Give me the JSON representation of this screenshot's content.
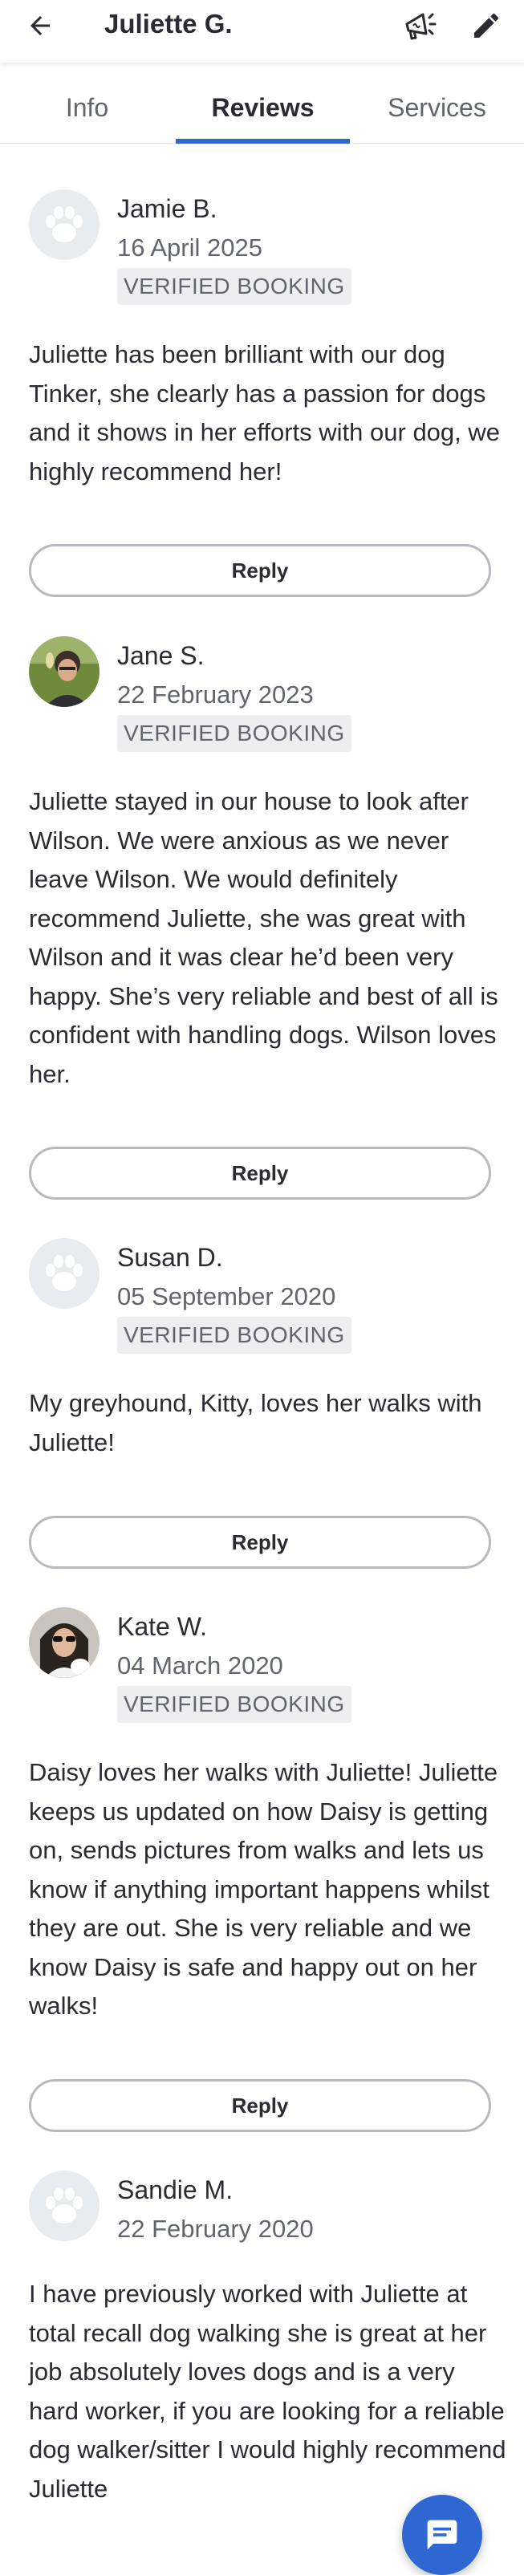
{
  "header": {
    "title": "Juliette G.",
    "back_icon": "arrow-left-icon",
    "promote_icon": "megaphone-icon",
    "edit_icon": "pencil-icon"
  },
  "tabs": [
    {
      "label": "Info",
      "active": false
    },
    {
      "label": "Reviews",
      "active": true
    },
    {
      "label": "Services",
      "active": false
    }
  ],
  "colors": {
    "accent": "#2e67d1",
    "text": "#2b2b33",
    "muted": "#62646e",
    "badge_bg": "#eeeef1"
  },
  "reviews": [
    {
      "name": "Jamie B.",
      "date": "16 April 2025",
      "badge": "VERIFIED BOOKING",
      "avatar": "paw-placeholder",
      "text": "Juliette has been brilliant with our dog Tinker, she clearly has a passion for dogs and it shows in her efforts with our dog, we highly recommend her!",
      "reply_label": "Reply"
    },
    {
      "name": "Jane S.",
      "date": "22 February 2023",
      "badge": "VERIFIED BOOKING",
      "avatar": "photo",
      "text": "Juliette stayed in our house to look after Wilson. We were anxious as we never leave Wilson. We would definitely recommend Juliette, she was great with Wilson and it was clear he’d been very happy. She’s very reliable and best of all is confident with handling dogs. Wilson loves her.",
      "reply_label": "Reply"
    },
    {
      "name": "Susan D.",
      "date": "05 September 2020",
      "badge": "VERIFIED BOOKING",
      "avatar": "paw-placeholder",
      "text": "My greyhound, Kitty, loves her walks with Juliette!",
      "reply_label": "Reply"
    },
    {
      "name": "Kate W.",
      "date": "04 March 2020",
      "badge": "VERIFIED BOOKING",
      "avatar": "photo",
      "text": "Daisy loves her walks with Juliette! Juliette keeps us updated on how Daisy is getting on, sends pictures from walks and lets us know if anything important happens whilst they are out. She is very reliable and we know Daisy is safe and happy out on her walks!",
      "reply_label": "Reply"
    },
    {
      "name": "Sandie M.",
      "date": "22 February 2020",
      "avatar": "paw-placeholder",
      "text": "I have previously worked with Juliette at total recall dog walking she is great at her job absolutely loves dogs and is a very hard worker, if you are looking for a reliable dog walker/sitter I would highly recommend Juliette"
    }
  ],
  "chat_fab": {
    "icon": "chat-bubble-icon"
  }
}
